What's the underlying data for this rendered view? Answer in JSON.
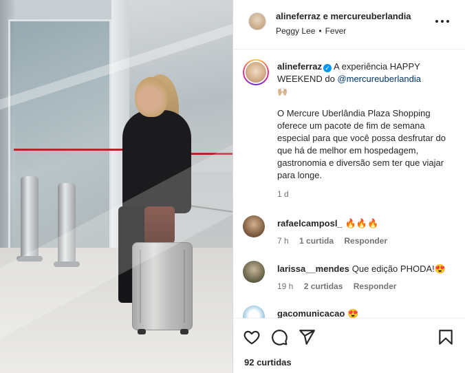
{
  "header": {
    "title": "alineferraz e mercureuberlandia",
    "audio_artist": "Peggy Lee",
    "audio_separator": "•",
    "audio_track": "Fever"
  },
  "caption": {
    "username": "alineferraz",
    "text_before_mention": "A experiência HAPPY WEEKEND do ",
    "mention": "@mercureuberlandia",
    "emojis": "🙌🏼",
    "paragraph": "O Mercure Uberlândia Plaza Shopping oferece um pacote de fim de semana especial para que você possa desfrutar do que há de melhor em hospedagem, gastronomia e diversão sem ter que viajar para longe.",
    "time": "1 d"
  },
  "comments": [
    {
      "username": "rafaelcamposl_",
      "text": "🔥🔥🔥",
      "time": "7 h",
      "likes": "1 curtida",
      "reply": "Responder"
    },
    {
      "username": "larissa__mendes",
      "text": "Que edição PHODA!😍",
      "time": "19 h",
      "likes": "2 curtidas",
      "reply": "Responder"
    },
    {
      "username": "gacomunicacao",
      "text": "😍",
      "time": "",
      "likes": "",
      "reply": ""
    }
  ],
  "actions": {
    "like_icon": "heart-icon",
    "comment_icon": "comment-icon",
    "share_icon": "share-icon",
    "save_icon": "bookmark-icon",
    "likes_count": "92 curtidas"
  },
  "colors": {
    "text": "#262626",
    "secondary": "#737373",
    "mention": "#00376b",
    "verified": "#0095f6"
  }
}
